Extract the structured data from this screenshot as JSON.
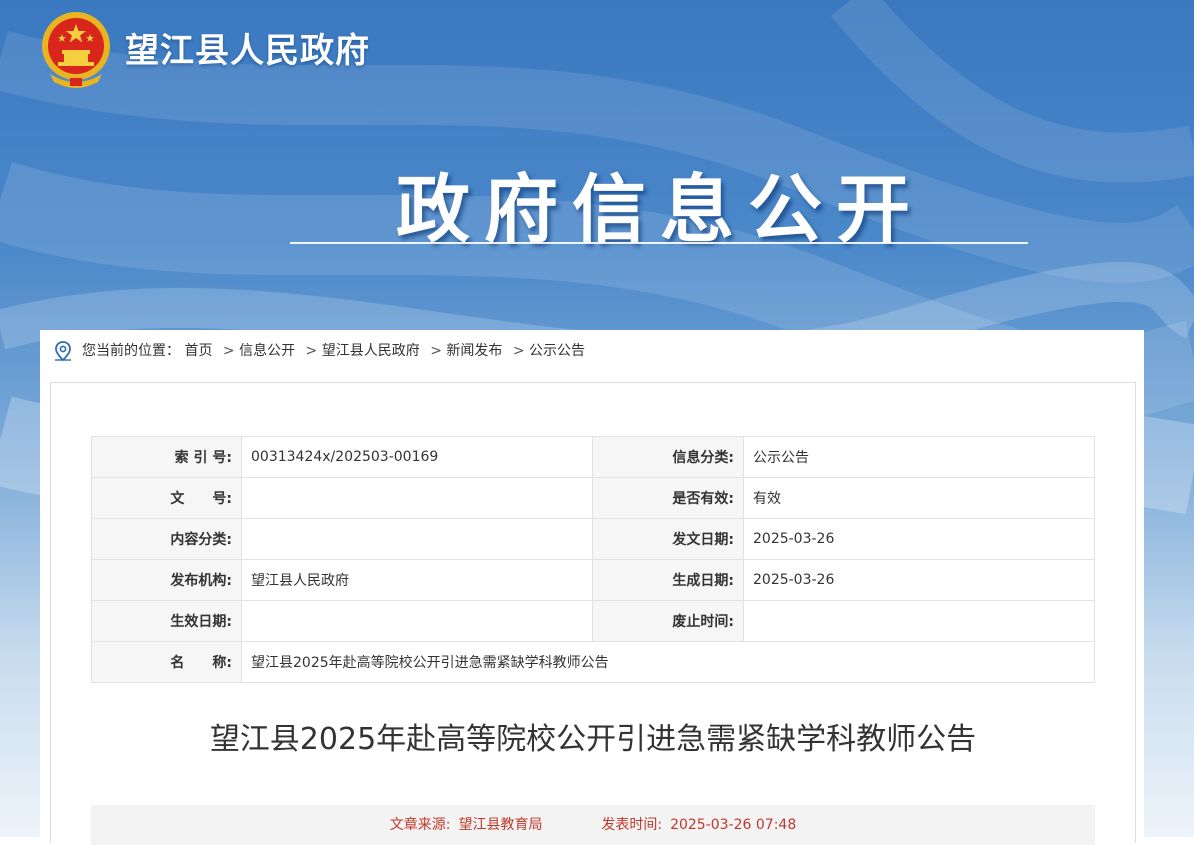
{
  "header": {
    "site_title": "望江县人民政府",
    "section_title": "政府信息公开",
    "emblem_icon": "national-emblem-icon"
  },
  "breadcrumb": {
    "prefix": "您当前的位置：",
    "items": [
      "首页",
      "信息公开",
      "望江县人民政府",
      "新闻发布",
      "公示公告"
    ],
    "separator": ">"
  },
  "meta_table": {
    "rows": [
      {
        "label1": "索 引 号:",
        "value1": "00313424x/202503-00169",
        "label2": "信息分类:",
        "value2": "公示公告"
      },
      {
        "label1": "文　　号:",
        "value1": "",
        "label2": "是否有效:",
        "value2": "有效"
      },
      {
        "label1": "内容分类:",
        "value1": "",
        "label2": "发文日期:",
        "value2": "2025-03-26"
      },
      {
        "label1": "发布机构:",
        "value1": "望江县人民政府",
        "label2": "生成日期:",
        "value2": "2025-03-26"
      },
      {
        "label1": "生效日期:",
        "value1": "",
        "label2": "废止时间:",
        "value2": ""
      }
    ],
    "name_row": {
      "label": "名　　称:",
      "value": "望江县2025年赴高等院校公开引进急需紧缺学科教师公告"
    }
  },
  "article": {
    "title": "望江县2025年赴高等院校公开引进急需紧缺学科教师公告",
    "source_label": "文章来源:",
    "source_value": "望江县教育局",
    "time_label": "发表时间:",
    "time_value": "2025-03-26 07:48"
  },
  "colors": {
    "banner_top": "#3a78c0",
    "accent_red": "#c0392b"
  }
}
